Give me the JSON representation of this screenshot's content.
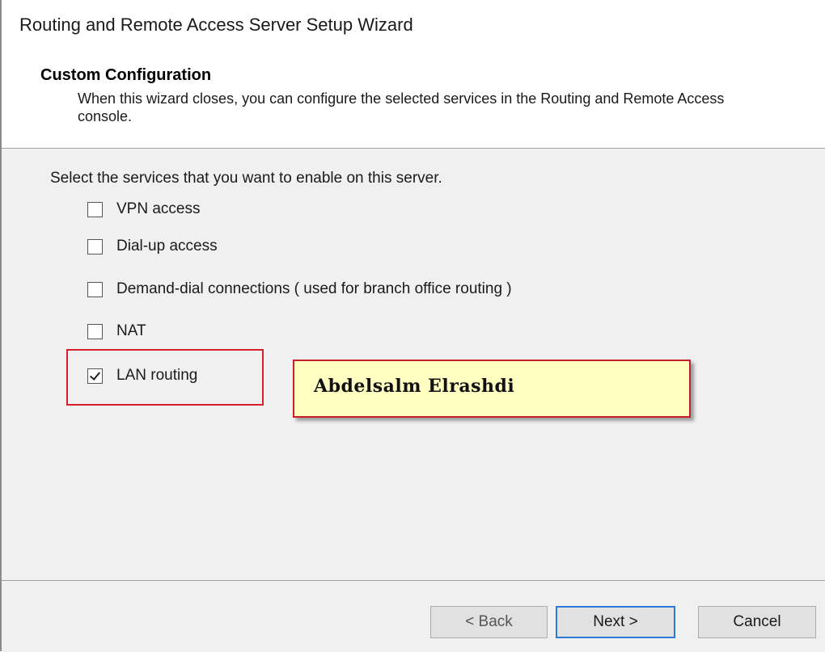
{
  "window": {
    "title": "Routing and Remote Access Server Setup Wizard"
  },
  "header": {
    "title": "Custom Configuration",
    "description": "When this wizard closes, you can configure the selected services in the Routing and Remote Access console."
  },
  "content": {
    "prompt": "Select the services that you want to enable on this server.",
    "options": [
      {
        "label": "VPN access",
        "checked": false
      },
      {
        "label": "Dial-up access",
        "checked": false
      },
      {
        "label": "Demand-dial connections ( used for branch office routing )",
        "checked": false
      },
      {
        "label": "NAT",
        "checked": false
      },
      {
        "label": "LAN routing",
        "checked": true
      }
    ]
  },
  "annotation": {
    "text": "Abdelsalm Elrashdi",
    "highlight_color": "#d6202a",
    "note_background": "#ffffc2"
  },
  "footer": {
    "back_label": "< Back",
    "next_label": "Next >",
    "cancel_label": "Cancel"
  }
}
